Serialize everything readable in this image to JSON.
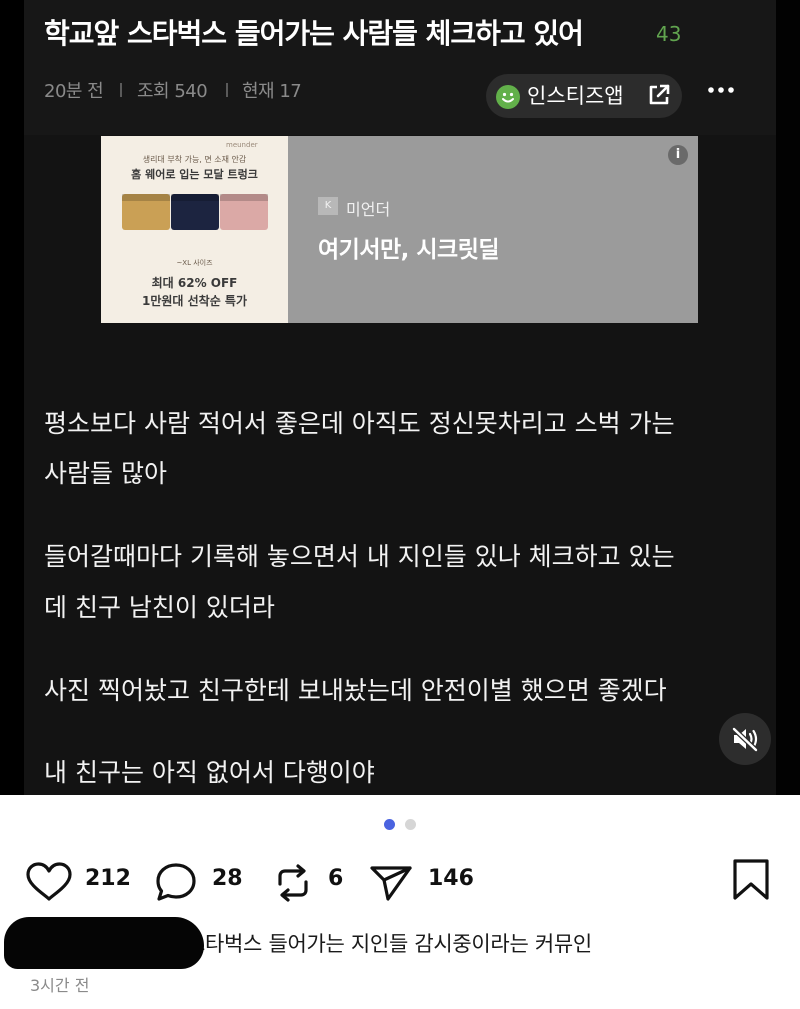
{
  "post": {
    "title": "학교앞 스타벅스 들어가는 사람들 체크하고 있어",
    "comment_count": "43",
    "meta": {
      "time": "20분 전",
      "views": "조회 540",
      "now": "현재 17"
    },
    "app_button_label": "인스티즈앱",
    "body": [
      "평소보다 사람 적어서 좋은데 아직도 정신못차리고 스벅 가는",
      "사람들 많아",
      "들어갈때마다 기록해 놓으면서 내 지인들 있나 체크하고 있는",
      "데 친구 남친이 있더라",
      "사진 찍어놨고 친구한테 보내놨는데 안전이별 했으면 좋겠다",
      "내 친구는 아직 없어서 다행이야"
    ]
  },
  "ad": {
    "brand_small": "meunder",
    "image_line1": "생리대 부착 가능, 면 소재 안감",
    "image_line2": "홈 웨어로 입는 모달 트렁크",
    "size_label": "~XL 사이즈",
    "discount": "최대 62% OFF",
    "sale": "1만원대 선착순 특가",
    "badge": "K",
    "advertiser": "미언더",
    "headline": "여기서만, 시크릿딜",
    "info": "i",
    "product_colors": [
      "#caa055",
      "#1c2440",
      "#dba9a6"
    ]
  },
  "carousel": {
    "active_index": 0,
    "count": 2,
    "active_color": "#4a63e0",
    "inactive_color": "#d6d6d6"
  },
  "actions": {
    "likes": "212",
    "comments": "28",
    "reposts": "6",
    "shares": "146"
  },
  "caption": {
    "text": "스타벅스 들어가는 지인들 감시중이라는 커뮤인",
    "time": "3시간 전"
  },
  "icons": {
    "like": "heart-icon",
    "comment": "comment-bubble-icon",
    "repost": "repost-icon",
    "share": "send-icon",
    "save": "bookmark-icon",
    "mute": "mute-icon",
    "external": "external-link-icon",
    "more": "more-icon"
  }
}
